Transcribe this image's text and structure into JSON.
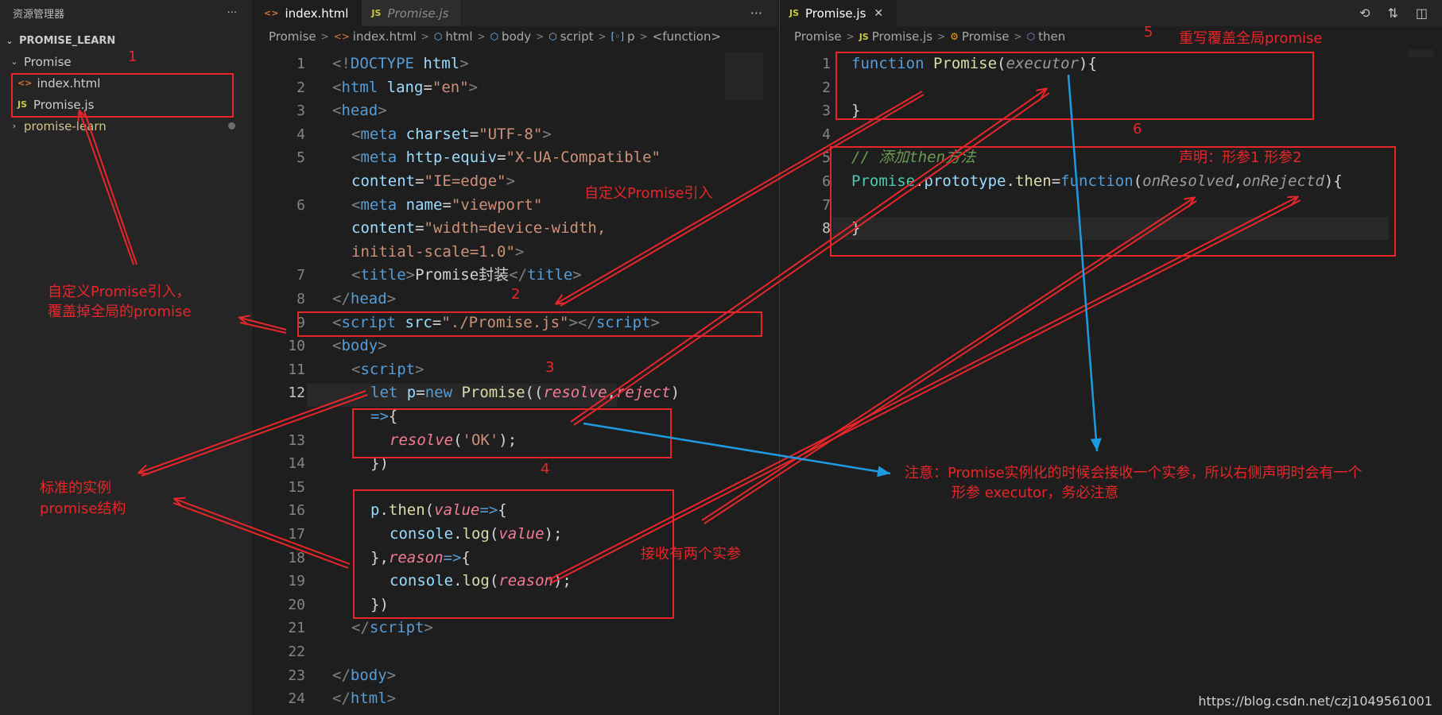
{
  "sidebar": {
    "title": "资源管理器",
    "more": "···",
    "section": "PROMISE_LEARN",
    "folder": "Promise",
    "files": [
      "index.html",
      "Promise.js"
    ],
    "other_folder": "promise-learn"
  },
  "left": {
    "tabs": [
      {
        "label": "index.html",
        "icon": "<>",
        "active": true
      },
      {
        "label": "Promise.js",
        "icon": "JS",
        "active": false
      }
    ],
    "more": "···",
    "breadcrumb": [
      "Promise",
      "index.html",
      "html",
      "body",
      "script",
      "p",
      "<function>"
    ]
  },
  "right": {
    "tab": {
      "label": "Promise.js",
      "icon": "JS",
      "close": "✕"
    },
    "breadcrumb": [
      "Promise",
      "Promise.js",
      "Promise",
      "then"
    ]
  },
  "annotations": {
    "n1": "1",
    "n2": "2",
    "n3": "3",
    "n4": "4",
    "n5": "5",
    "n6": "6",
    "custom_import": "自定义Promise引入",
    "custom_import_override_1": "自定义Promise引入，",
    "custom_import_override_2": "覆盖掉全局的promise",
    "standard_1": "标准的实例",
    "standard_2": "promise结构",
    "receive_two": "接收有两个实参",
    "rewrite_global": "重写覆盖全局promise",
    "declare_params": "声明：形参1  形参2",
    "note_1": "注意：Promise实例化的时候会接收一个实参，所以右侧声明时会有一个",
    "note_2": "形参 executor，务必注意"
  },
  "watermark": "https://blog.csdn.net/czj1049561001",
  "colors": {
    "annotation_red": "#e8262a",
    "arrow_blue": "#1e9be0",
    "editor_bg": "#1e1e1e"
  }
}
